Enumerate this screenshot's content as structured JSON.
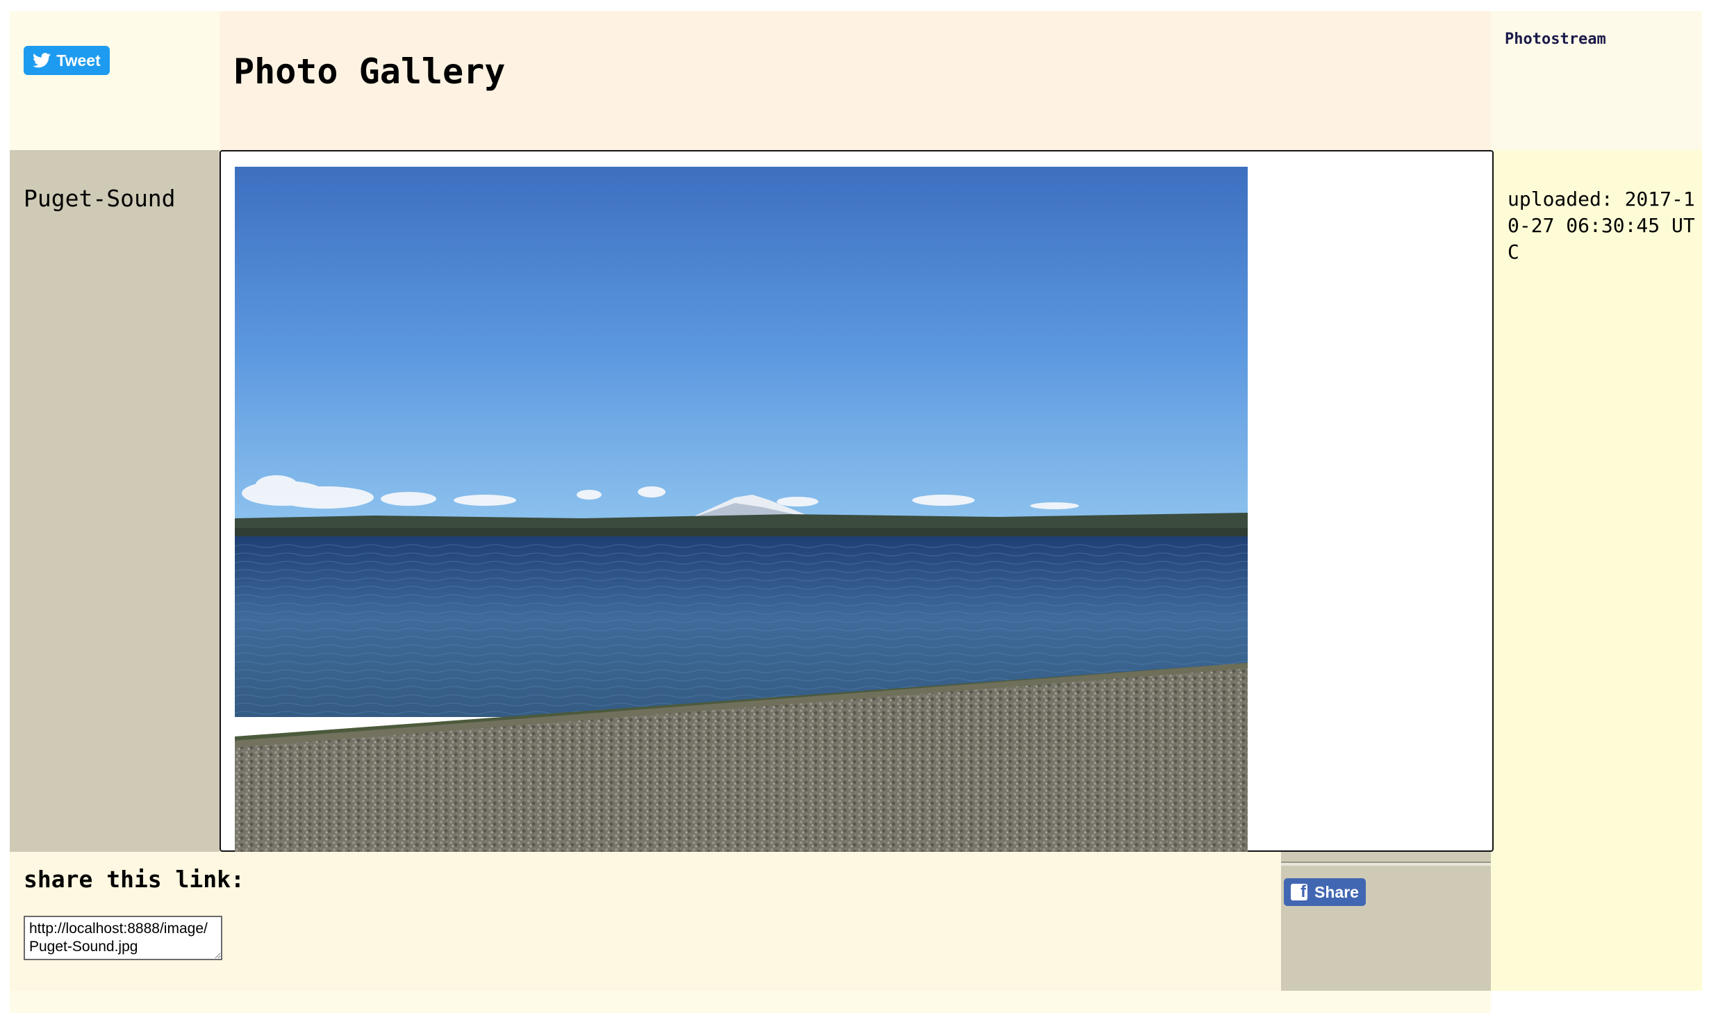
{
  "header": {
    "tweet_label": "Tweet",
    "title": "Photo Gallery",
    "nav_link": "Photostream"
  },
  "image": {
    "name": "Puget-Sound",
    "uploaded": "uploaded: 2017-10-27 06:30:45 UTC"
  },
  "share": {
    "label": "share this link:",
    "link": "http://localhost:8888/image/Puget-Sound.jpg",
    "fb_label": "Share"
  },
  "colors": {
    "tweet": "#1d9bf0",
    "facebook": "#4267b2",
    "sidebar": "#cfcab6"
  }
}
